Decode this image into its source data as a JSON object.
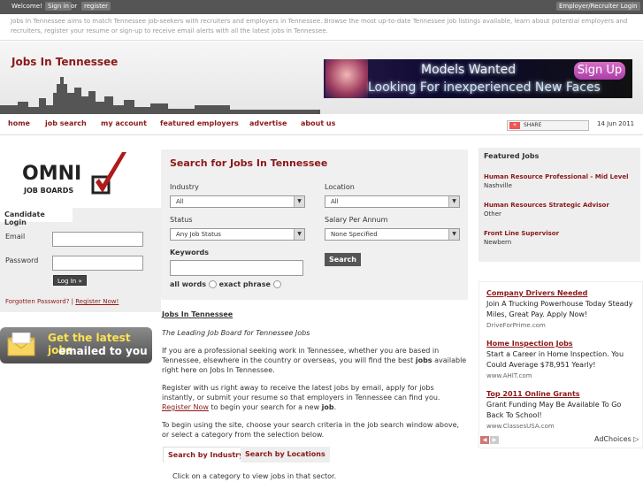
{
  "topbar": {
    "welcome": "Welcome!",
    "sign_in": "Sign in",
    "or": "or",
    "register": "register",
    "employer_login": "Employer/Recruiter Login"
  },
  "intro_text": "Jobs In Tennessee aims to match Tennessee job-seekers with recruiters and employers in Tennessee. Browse the most up-to-date Tennessee job listings available, learn about potential employers and recruiters, register your resume or sign-up to receive email alerts with all the latest jobs in Tennessee.",
  "header": {
    "logo": "Jobs In Tennessee",
    "banner_line1": "Models Wanted",
    "banner_line2": "Looking For inexperienced New Faces",
    "banner_button": "Sign Up"
  },
  "nav": {
    "items": [
      "home",
      "job search",
      "my account",
      "featured employers",
      "advertise",
      "about us"
    ],
    "share_label": "SHARE",
    "date": "14 Jun 2011"
  },
  "left": {
    "omni_line1": "OMNI",
    "omni_line2": "JOB BOARDS",
    "candidate_title": "Candidate Login",
    "email_label": "Email",
    "password_label": "Password",
    "login_button": "Log In »",
    "forgot_password": "Forgotten Password?",
    "register_now": "Register Now!",
    "email_promo_line1": "Get the latest jobs",
    "email_promo_line2": "emailed to you"
  },
  "search": {
    "title": "Search for Jobs In Tennessee",
    "industry_label": "Industry",
    "industry_value": "All",
    "location_label": "Location",
    "location_value": "All",
    "status_label": "Status",
    "status_value": "Any Job Status",
    "salary_label": "Salary Per Annum",
    "salary_value": "None Specified",
    "keywords_label": "Keywords",
    "all_words": "all words",
    "exact_phrase": "exact phrase",
    "search_button": "Search"
  },
  "content": {
    "heading": "Jobs In Tennessee",
    "tagline": "The Leading Job Board for Tennessee Jobs",
    "para1_pre": "If you are a professional seeking work in Tennessee, whether you are based in Tennessee, elsewhere in the country or overseas, you will find the best ",
    "para1_bold": "jobs",
    "para1_post": " available right here on Jobs In Tennessee.",
    "para2_pre": "Register with us right away to receive the latest jobs by email, apply for jobs instantly, or submit your resume so that employers in Tennessee can find you. ",
    "para2_link": "Register Now",
    "para2_mid": " to begin your search for a new ",
    "para2_bold": "job",
    "para2_end": ".",
    "para3": "To begin using the site, choose your search criteria in the job search window above, or select a category from the selection below.",
    "tab1": "Search by Industry",
    "tab2": "Search by Locations",
    "tab_hint": "Click on a category to view jobs in that sector."
  },
  "featured": {
    "title": "Featured Jobs",
    "jobs": [
      {
        "title": "Human Resource Professional - Mid Level",
        "location": "Nashville"
      },
      {
        "title": "Human Resources Strategic Advisor",
        "location": "Other"
      },
      {
        "title": "Front Line Supervisor",
        "location": "Newbern"
      }
    ]
  },
  "ads": {
    "items": [
      {
        "title": "Company Drivers Needed",
        "desc": "Join A Trucking Powerhouse Today Steady Miles, Great Pay. Apply Now!",
        "url": "DriveForPrime.com"
      },
      {
        "title": "Home Inspection Jobs",
        "desc": "Start a Career in Home Inspection. You Could Average $78,951 Yearly!",
        "url": "www.AHIT.com"
      },
      {
        "title": "Top 2011 Online Grants",
        "desc": "Grant Funding May Be Available To Go Back To School!",
        "url": "www.ClassesUSA.com"
      }
    ],
    "adchoices": "AdChoices ▷"
  }
}
